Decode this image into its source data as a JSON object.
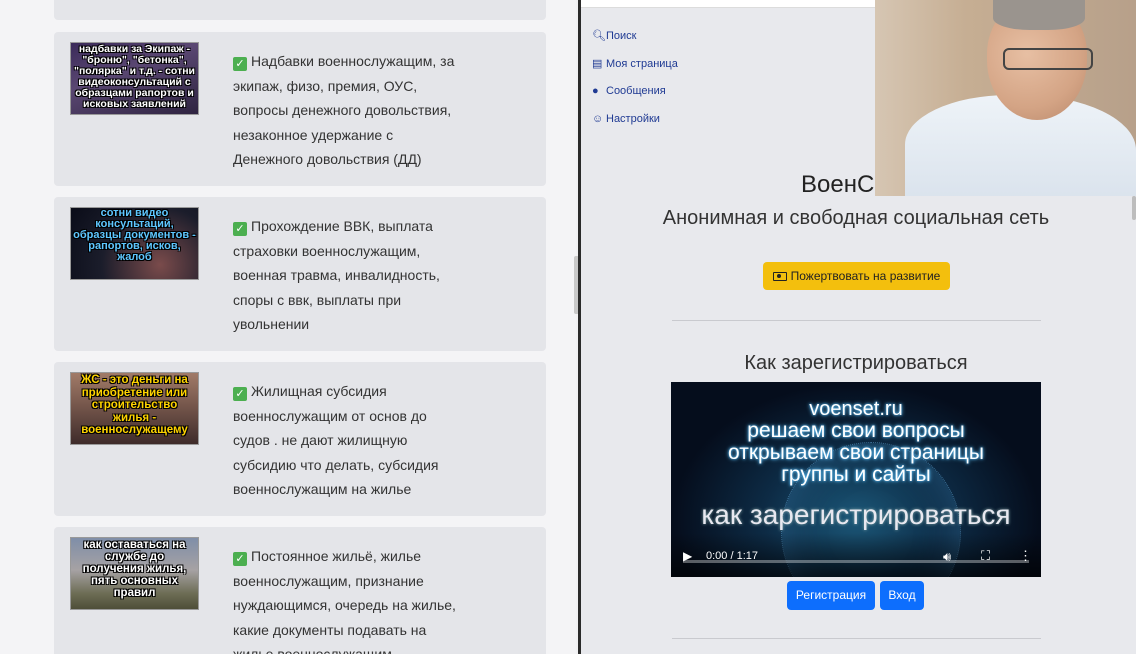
{
  "left": {
    "cards": [
      {
        "thumb_text": "надбавки за Экипаж - \"броню\", \"бетонка\", \"полярка\" и т.д. - сотни видеоконсультаций с образцами рапортов и исковых заявлений",
        "text": "Надбавки военнослужащим, за экипаж, физо, премия, ОУС, вопросы денежного довольствия, незаконное удержание с Денежного довольствия (ДД)"
      },
      {
        "thumb_text": "сотни видео консультаций, образцы документов - рапортов, исков, жалоб",
        "text": "Прохождение ВВК, выплата страховки военнослужащим, военная травма, инвалидность, споры с ввк, выплаты при увольнении"
      },
      {
        "thumb_text": "ЖС - это деньги на приобретение или строительство жилья - военнослужащему",
        "text": "Жилищная субсидия военнослужащим от основ до судов . не дают жилищную субсидию что делать, субсидия военнослужащим на жилье"
      },
      {
        "thumb_text": "как оставаться на службе до получения жилья, пять основных правил",
        "text": "Постоянное жильё, жилье военнослужащим, признание нуждающимся, очередь на жилье, какие документы подавать на жилье военнослужащим"
      }
    ]
  },
  "nav": {
    "search": "Поиск",
    "my_page": "Моя страница",
    "messages": "Сообщения",
    "settings": "Настройки"
  },
  "right": {
    "site_title": "ВоенС",
    "subtitle": "Анонимная и свободная социальная сеть",
    "donate_label": "Пожертвовать на развитие",
    "how_title": "Как зарегистрироваться",
    "video": {
      "line1": "voenset.ru",
      "line2": "решаем свои вопросы",
      "line3": "открываем свои страницы",
      "line4": "группы и сайты",
      "line5": "как зарегистрироваться",
      "time": "0:00 / 1:17",
      "progress": 0
    },
    "register_label": "Регистрация",
    "login_label": "Вход"
  }
}
